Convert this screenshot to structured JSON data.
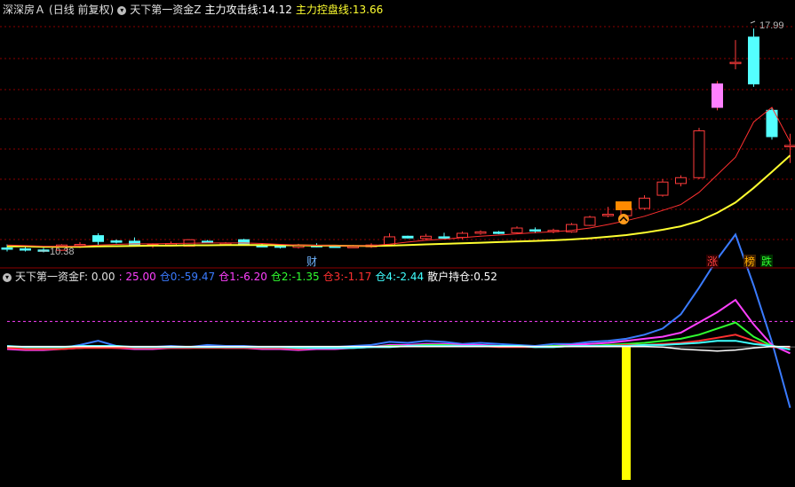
{
  "top_panel": {
    "stock_name": "深深房Ａ",
    "period": "(日线 前复权)",
    "indicator": "天下第一资金Z",
    "attack_label": "主力攻击线:",
    "attack_value": "14.12",
    "control_label": "主力控盘线:",
    "control_value": "13.66",
    "high_label": "17.99",
    "low_label": "10.38",
    "marker_cai": "财",
    "marker_zhang": "涨",
    "marker_bang": "榜",
    "marker_die": "跌"
  },
  "bottom_panel": {
    "indicator": "天下第一资金F",
    "v0": ": 0.00",
    "v1": ": 25.00",
    "c0_label": "仓0:",
    "c0_value": "-59.47",
    "c1_label": "仓1:",
    "c1_value": "-6.20",
    "c2_label": "仓2:",
    "c2_value": "-1.35",
    "c3_label": "仓3:",
    "c3_value": "-1.17",
    "c4_label": "仓4:",
    "c4_value": "-2.44",
    "retail_label": "散户持仓:",
    "retail_value": "0.52"
  },
  "colors": {
    "up": "#ff3b3b",
    "down": "#54ffff",
    "attack_line": "#ff3030",
    "control_line": "#ffff30",
    "grid": "#8b0000",
    "c0": "#3a7bff",
    "c1": "#ff40ff",
    "c2": "#30ff30",
    "c3": "#ff3030",
    "c4": "#40ffff",
    "retail": "#ffffff",
    "bar": "#ffff00"
  },
  "chart_data": [
    {
      "type": "candlestick",
      "price_range": [
        10.0,
        18.3
      ],
      "candles": [
        [
          10.5,
          10.48,
          10.62,
          10.38
        ],
        [
          10.47,
          10.43,
          10.55,
          10.38
        ],
        [
          10.43,
          10.41,
          10.5,
          10.35
        ],
        [
          10.42,
          10.6,
          10.63,
          10.4
        ],
        [
          10.58,
          10.62,
          10.7,
          10.5
        ],
        [
          10.92,
          10.72,
          11.0,
          10.6
        ],
        [
          10.74,
          10.7,
          10.79,
          10.65
        ],
        [
          10.73,
          10.58,
          10.86,
          10.55
        ],
        [
          10.6,
          10.62,
          10.66,
          10.5
        ],
        [
          10.63,
          10.65,
          10.72,
          10.6
        ],
        [
          10.56,
          10.78,
          10.8,
          10.54
        ],
        [
          10.73,
          10.71,
          10.77,
          10.68
        ],
        [
          10.63,
          10.66,
          10.7,
          10.6
        ],
        [
          10.78,
          10.63,
          10.81,
          10.58
        ],
        [
          10.58,
          10.56,
          10.66,
          10.54
        ],
        [
          10.57,
          10.52,
          10.62,
          10.48
        ],
        [
          10.52,
          10.58,
          10.64,
          10.48
        ],
        [
          10.58,
          10.56,
          10.66,
          10.52
        ],
        [
          10.56,
          10.54,
          10.6,
          10.51
        ],
        [
          10.54,
          10.55,
          10.6,
          10.52
        ],
        [
          10.54,
          10.6,
          10.66,
          10.5
        ],
        [
          10.6,
          10.88,
          11.0,
          10.58
        ],
        [
          10.9,
          10.84,
          10.92,
          10.82
        ],
        [
          10.82,
          10.9,
          10.98,
          10.78
        ],
        [
          10.88,
          10.86,
          11.02,
          10.83
        ],
        [
          10.86,
          11.0,
          11.06,
          10.8
        ],
        [
          11.0,
          11.05,
          11.1,
          10.95
        ],
        [
          11.04,
          11.02,
          11.08,
          10.97
        ],
        [
          11.02,
          11.18,
          11.24,
          11.0
        ],
        [
          11.12,
          11.1,
          11.2,
          11.0
        ],
        [
          11.1,
          11.1,
          11.16,
          11.0
        ],
        [
          11.05,
          11.3,
          11.35,
          11.02
        ],
        [
          11.27,
          11.55,
          11.6,
          11.25
        ],
        [
          11.6,
          11.65,
          11.9,
          11.55
        ],
        [
          11.6,
          11.85,
          11.9,
          11.5
        ],
        [
          11.85,
          12.2,
          12.3,
          11.8
        ],
        [
          12.3,
          12.75,
          12.85,
          12.25
        ],
        [
          12.7,
          12.9,
          12.98,
          12.6
        ],
        [
          12.9,
          14.5,
          14.6,
          12.85
        ],
        [
          15.3,
          16.1,
          16.2,
          15.2
        ],
        [
          16.8,
          16.84,
          17.6,
          16.6
        ],
        [
          17.7,
          16.1,
          17.99,
          16.0
        ],
        [
          15.2,
          14.3,
          15.3,
          14.2
        ],
        [
          14.0,
          14.0,
          14.4,
          13.4
        ]
      ],
      "attack_line": [
        10.6,
        10.58,
        10.56,
        10.55,
        10.56,
        10.6,
        10.62,
        10.64,
        10.64,
        10.65,
        10.66,
        10.67,
        10.67,
        10.67,
        10.65,
        10.62,
        10.6,
        10.59,
        10.58,
        10.57,
        10.58,
        10.63,
        10.7,
        10.76,
        10.8,
        10.85,
        10.9,
        10.94,
        10.98,
        11.02,
        11.05,
        11.1,
        11.18,
        11.3,
        11.43,
        11.58,
        11.78,
        11.98,
        12.4,
        13.0,
        13.6,
        14.8,
        15.3,
        14.12
      ],
      "control_line": [
        10.55,
        10.55,
        10.54,
        10.54,
        10.54,
        10.55,
        10.56,
        10.57,
        10.58,
        10.58,
        10.59,
        10.59,
        10.6,
        10.6,
        10.6,
        10.59,
        10.59,
        10.58,
        10.58,
        10.57,
        10.57,
        10.58,
        10.6,
        10.62,
        10.64,
        10.66,
        10.68,
        10.7,
        10.72,
        10.74,
        10.76,
        10.79,
        10.83,
        10.88,
        10.94,
        11.02,
        11.12,
        11.24,
        11.42,
        11.7,
        12.05,
        12.55,
        13.1,
        13.66
      ]
    },
    {
      "type": "line",
      "series": [
        {
          "name": "仓0",
          "values": [
            -1,
            -1,
            -2,
            -1,
            2,
            6,
            1,
            -1,
            0,
            1,
            0,
            2,
            1,
            1,
            0,
            -1,
            -2,
            -1,
            0,
            1,
            2,
            5,
            4,
            6,
            5,
            3,
            4,
            3,
            2,
            1,
            3,
            3,
            5,
            6,
            8,
            12,
            18,
            32,
            58,
            86,
            110,
            60,
            5,
            -59.47
          ]
        },
        {
          "name": "仓1",
          "values": [
            -2,
            -3,
            -3,
            -2,
            -1,
            0,
            -1,
            -2,
            -2,
            -1,
            -1,
            0,
            -1,
            -1,
            -2,
            -2,
            -3,
            -2,
            -2,
            -1,
            0,
            2,
            2,
            3,
            3,
            2,
            2,
            1,
            1,
            0,
            1,
            2,
            3,
            4,
            6,
            8,
            10,
            14,
            24,
            34,
            46,
            22,
            2,
            -6.2
          ]
        },
        {
          "name": "仓2",
          "values": [
            0,
            0,
            -1,
            -1,
            -1,
            0,
            0,
            -1,
            -1,
            0,
            0,
            0,
            0,
            0,
            -1,
            -1,
            -1,
            -1,
            -1,
            0,
            0,
            1,
            1,
            2,
            2,
            1,
            1,
            1,
            1,
            0,
            1,
            1,
            1,
            2,
            3,
            4,
            6,
            8,
            12,
            18,
            24,
            10,
            1,
            -1.35
          ]
        },
        {
          "name": "仓3",
          "values": [
            -1,
            -2,
            -2,
            -2,
            -1,
            -1,
            -1,
            -1,
            -1,
            -1,
            -1,
            -1,
            -1,
            -1,
            -1,
            -1,
            -2,
            -1,
            -1,
            -1,
            0,
            0,
            1,
            1,
            1,
            1,
            1,
            0,
            0,
            0,
            0,
            1,
            1,
            1,
            2,
            2,
            3,
            4,
            6,
            9,
            12,
            6,
            0,
            -1.17
          ]
        },
        {
          "name": "仓4",
          "values": [
            1,
            0,
            0,
            0,
            1,
            1,
            1,
            0,
            0,
            0,
            0,
            0,
            0,
            0,
            0,
            0,
            -1,
            -1,
            -1,
            -1,
            0,
            0,
            1,
            1,
            1,
            1,
            1,
            1,
            1,
            0,
            0,
            1,
            1,
            1,
            1,
            2,
            2,
            3,
            4,
            6,
            6,
            3,
            1,
            -2.44
          ]
        },
        {
          "name": "散户持仓",
          "values": [
            0.5,
            0.5,
            0.5,
            0.5,
            0.5,
            0.5,
            0.5,
            0.5,
            0.5,
            0.5,
            0.5,
            0.5,
            0.5,
            0.5,
            0.5,
            0.5,
            0.5,
            0.5,
            0.5,
            0.5,
            0.5,
            0.5,
            0.5,
            0.5,
            0.5,
            0.5,
            0.5,
            0.5,
            0.5,
            0.5,
            0.5,
            0.5,
            0.5,
            0.5,
            0.5,
            0.5,
            0,
            -2,
            -3,
            -4,
            -3,
            -1,
            0.5,
            0.52
          ]
        }
      ],
      "reference_lines": [
        0,
        25
      ],
      "signal_bar": {
        "index": 34,
        "value": -130
      },
      "y_range": [
        -130,
        60
      ]
    }
  ]
}
